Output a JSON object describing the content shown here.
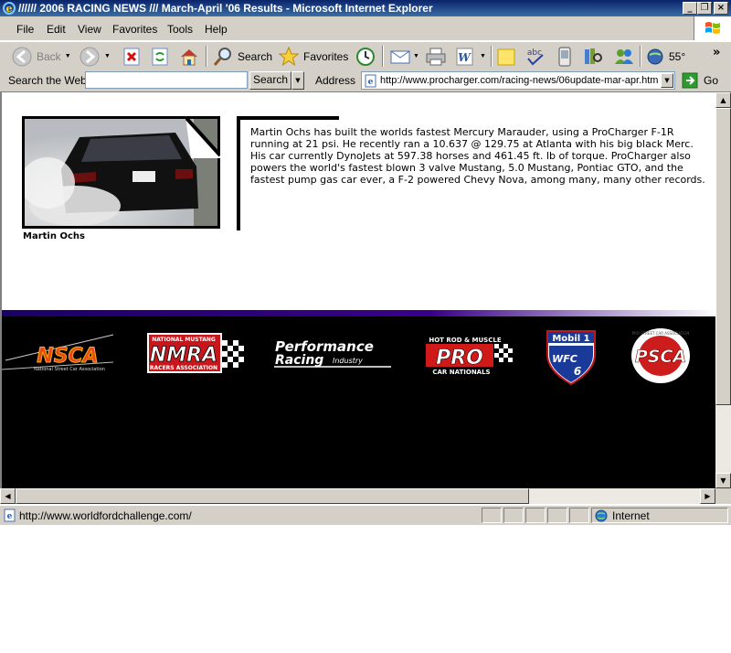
{
  "window": {
    "title": "////// 2006 RACING NEWS /// March-April '06 Results - Microsoft Internet Explorer",
    "controls": [
      "_",
      "❐",
      "×"
    ]
  },
  "menu": [
    "File",
    "Edit",
    "View",
    "Favorites",
    "Tools",
    "Help"
  ],
  "toolbar": {
    "back_label": "Back",
    "search_label": "Search",
    "favorites_label": "Favorites",
    "weather_label": "55°",
    "more_label": "»"
  },
  "addressbar": {
    "search_web_label": "Search the Web",
    "search_input_value": "",
    "search_button_label": "Search",
    "address_label": "Address",
    "url": "http://www.procharger.com/racing-news/06update-mar-apr.htm",
    "go_label": "Go"
  },
  "article": {
    "photo_caption": "Martin Ochs",
    "body": "Martin Ochs has built the worlds fastest Mercury Marauder, using a ProCharger F-1R running at 21 psi. He recently ran a 10.637 @ 129.75 at Atlanta with his big black Merc. His car currently DynoJets at 597.38 horses and 461.45 ft. lb of torque. ProCharger also powers the world's fastest blown 3 valve Mustang, 5.0 Mustang, Pontiac GTO, and the fastest pump gas car ever, a F-2 powered Chevy Nova, among many, many other records."
  },
  "sponsors": {
    "nsca": {
      "main": "NSCA",
      "sub": "National Street Car Association"
    },
    "nmra": {
      "top": "NATIONAL MUSTANG",
      "main": "NMRA",
      "sub": "RACERS ASSOCIATION"
    },
    "pri": {
      "line1": "Performance",
      "line2": "Racing",
      "line3": "Industry"
    },
    "hotrod": {
      "top": "HOT ROD & MUSCLE",
      "main": "PRO",
      "sub": "CAR NATIONALS"
    },
    "mobil": {
      "top": "Mobil 1",
      "main": "WFC",
      "num": "6"
    },
    "psca": {
      "main": "PSCA",
      "ring": "PRO STREET CAR ASSOCIATION"
    }
  },
  "statusbar": {
    "text": "http://www.worldfordchallenge.com/",
    "zone": "Internet"
  }
}
